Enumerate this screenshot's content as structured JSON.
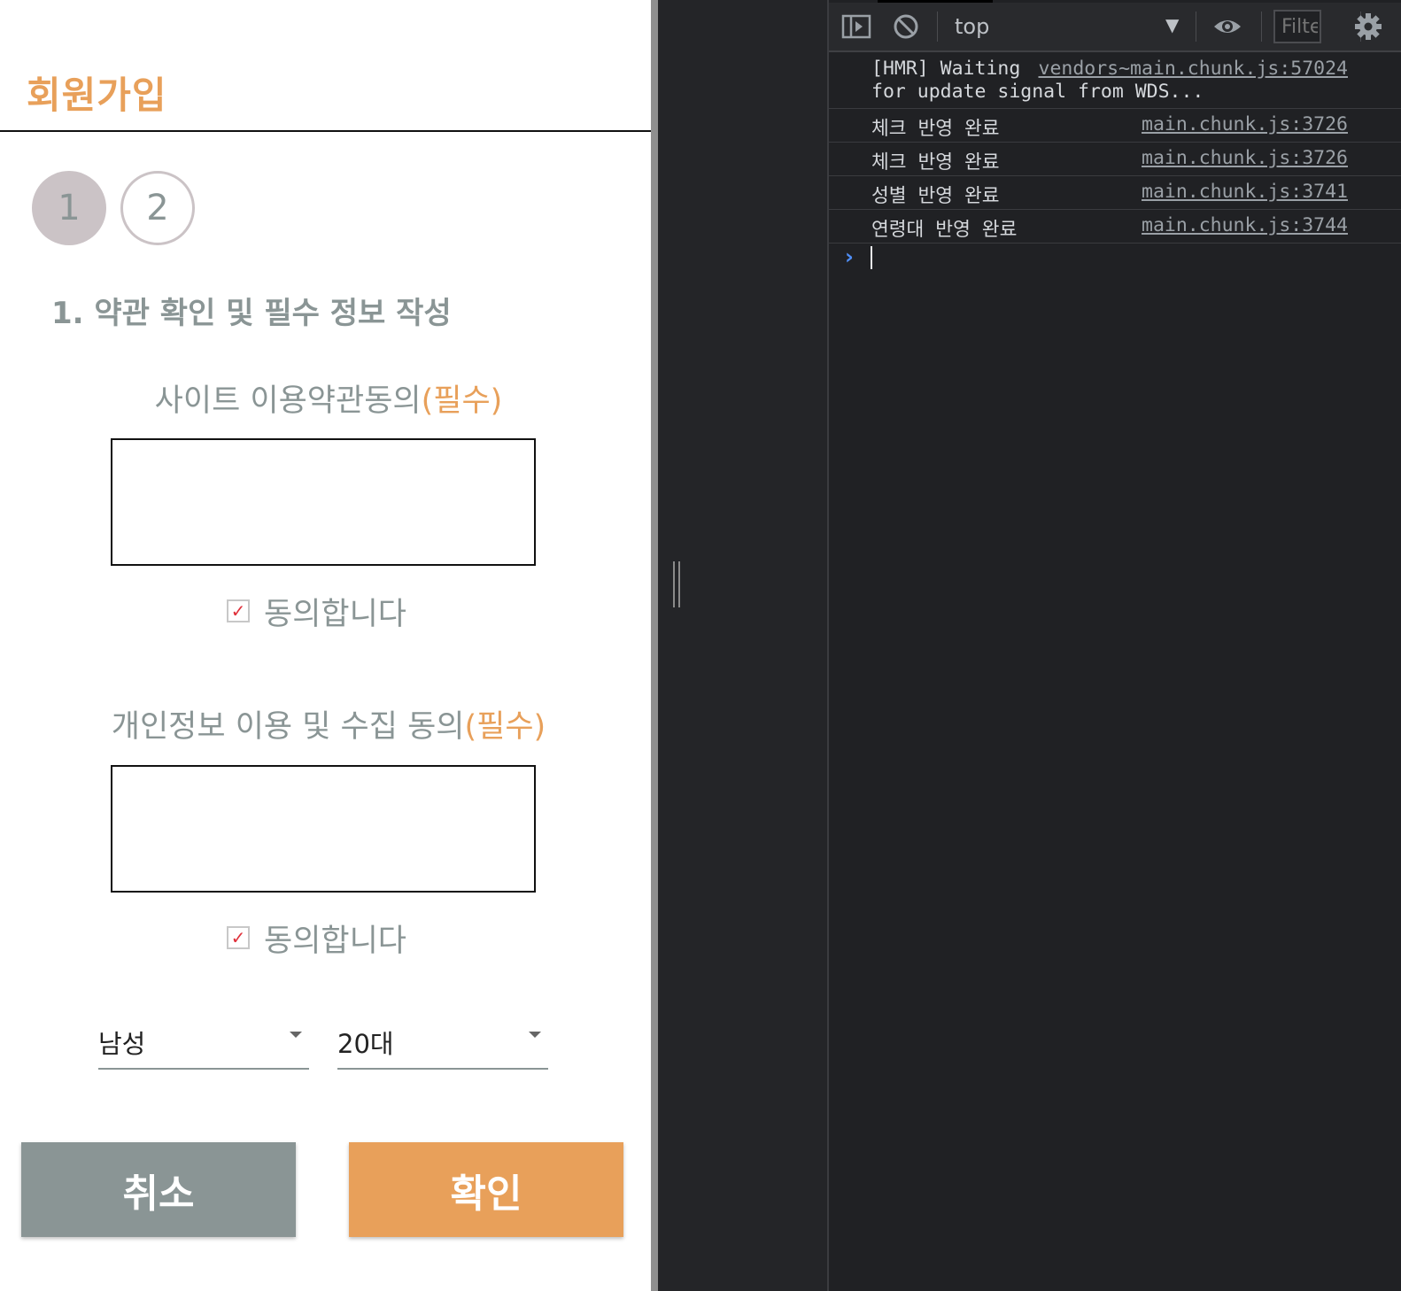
{
  "colors": {
    "accent": "#e8a05a",
    "muted": "#8a9595",
    "checkmark": "#e0303a",
    "console_bg": "#202124"
  },
  "app": {
    "title": "회원가입",
    "steps": [
      "1",
      "2"
    ],
    "section_heading": "1. 약관 확인 및 필수 정보 작성",
    "site_terms": {
      "label": "사이트 이용약관동의",
      "required": "(필수)",
      "agree": "동의합니다",
      "checked": true
    },
    "privacy_terms": {
      "label": "개인정보 이용 및 수집 동의",
      "required": "(필수)",
      "agree": "동의합니다",
      "checked": true
    },
    "gender_select": {
      "value": "남성"
    },
    "age_select": {
      "value": "20대"
    },
    "cancel_label": "취소",
    "confirm_label": "확인"
  },
  "devtools": {
    "toolbar": {
      "sidebar_icon": "sidebar-toggle-icon",
      "clear_icon": "clear-console-icon",
      "context": "top",
      "dropdown_icon": "triangle-down-icon",
      "eye_icon": "live-expression-eye-icon",
      "filter_placeholder": "Filter",
      "settings_icon": "gear-icon"
    },
    "logs": [
      {
        "message": "[HMR] Waiting",
        "message_line2": "for update signal from WDS...",
        "source": "vendors~main.chunk.js:57024"
      },
      {
        "message": "체크 반영 완료",
        "source": "main.chunk.js:3726"
      },
      {
        "message": "체크 반영 완료",
        "source": "main.chunk.js:3726"
      },
      {
        "message": "성별 반영 완료",
        "source": "main.chunk.js:3741"
      },
      {
        "message": "연령대 반영 완료",
        "source": "main.chunk.js:3744"
      }
    ],
    "prompt_symbol": "›"
  }
}
